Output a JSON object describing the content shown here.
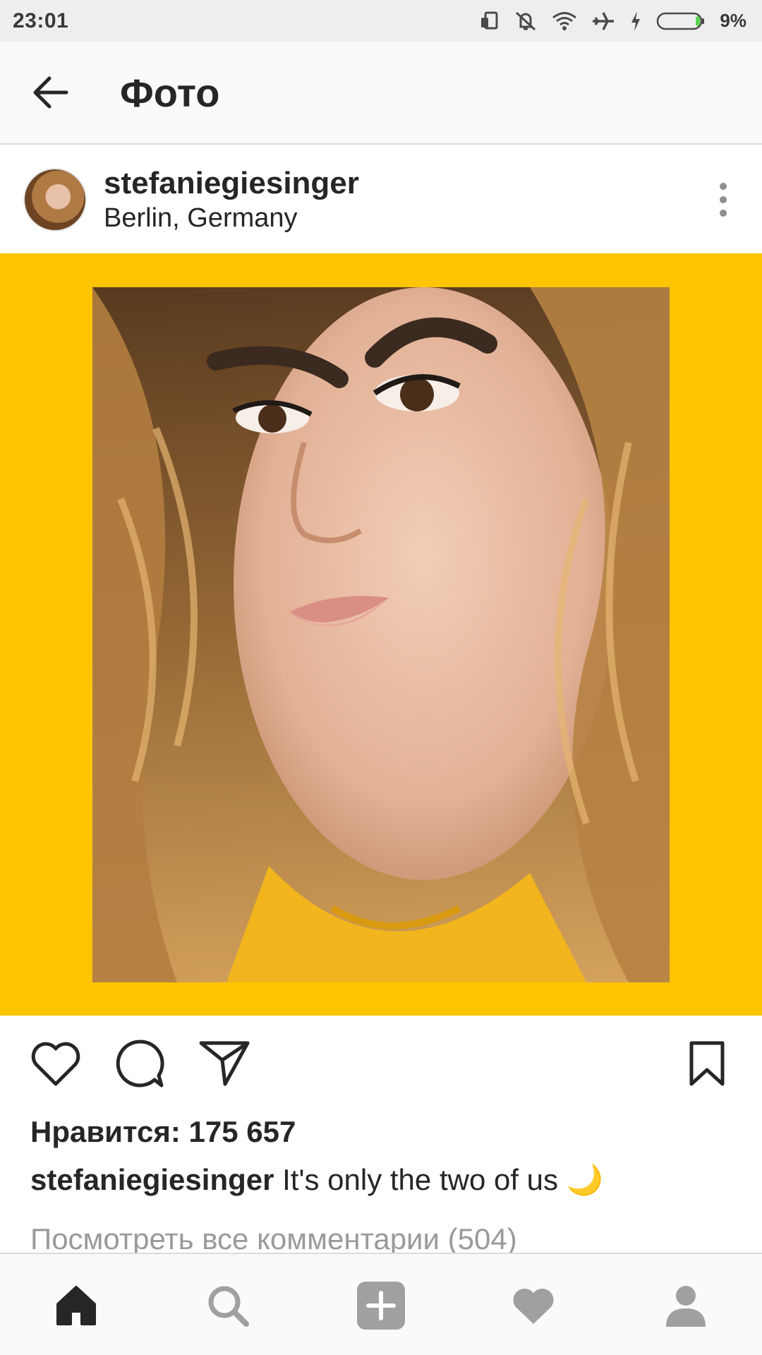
{
  "status_bar": {
    "time": "23:01",
    "battery_percent": "9%",
    "battery_level": 0.09,
    "icons": [
      "rotate-icon",
      "vibrate-off-icon",
      "wifi-icon",
      "airplane-icon",
      "charging-icon",
      "battery-icon"
    ]
  },
  "app_bar": {
    "title": "Фото",
    "back_icon": "arrow-left-icon"
  },
  "post": {
    "author": "stefaniegiesinger",
    "location": "Berlin, Germany",
    "photo_border_color": "#ffc400",
    "likes_text": "Нравится: 175 657",
    "caption_user": "stefaniegiesinger",
    "caption_text": "It's only the two of us 🌙",
    "view_comments": "Посмотреть все комментарии (504)"
  },
  "actions": [
    "like-icon",
    "comment-icon",
    "share-icon",
    "bookmark-icon"
  ],
  "bottom_nav": {
    "items": [
      "home-icon",
      "search-icon",
      "add-post-icon",
      "activity-heart-icon",
      "profile-icon"
    ],
    "active": "home-icon"
  }
}
